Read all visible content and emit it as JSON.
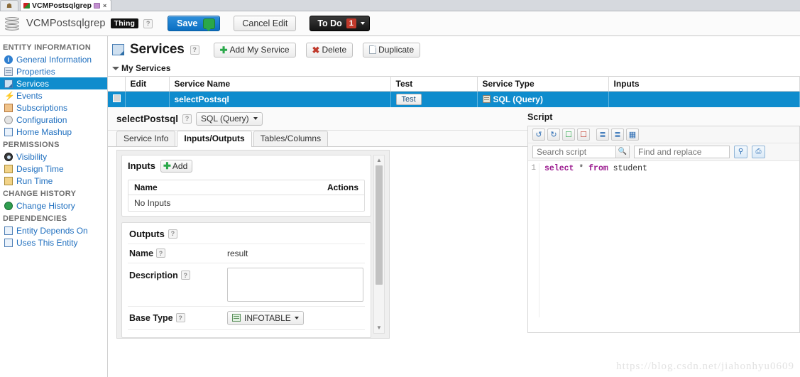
{
  "browser": {
    "home_tab_icon": "home-icon",
    "active_tab": {
      "label": "VCMPostsqlgrep",
      "favicon": "site-favicon",
      "badge_icon": "extension-badge-icon",
      "close_label": "×"
    }
  },
  "entity_bar": {
    "db_icon": "database-icon",
    "entity_name": "VCMPostsqlgrep",
    "type_badge": "Thing",
    "help_label": "?",
    "save_label": "Save",
    "save_bubble_icon": "comment-add-icon",
    "cancel_label": "Cancel Edit",
    "todo_label": "To Do",
    "todo_count": "1"
  },
  "sidebar": {
    "groups": [
      {
        "title": "ENTITY INFORMATION",
        "items": [
          {
            "label": "General Information",
            "icon": "info-icon",
            "active": false
          },
          {
            "label": "Properties",
            "icon": "properties-grid-icon",
            "active": false
          },
          {
            "label": "Services",
            "icon": "services-icon",
            "active": true
          },
          {
            "label": "Events",
            "icon": "lightning-bolt-icon",
            "active": false
          },
          {
            "label": "Subscriptions",
            "icon": "subscriptions-icon",
            "active": false
          },
          {
            "label": "Configuration",
            "icon": "gear-icon",
            "active": false
          },
          {
            "label": "Home Mashup",
            "icon": "mashup-icon",
            "active": false
          }
        ]
      },
      {
        "title": "PERMISSIONS",
        "items": [
          {
            "label": "Visibility",
            "icon": "eye-icon",
            "active": false
          },
          {
            "label": "Design Time",
            "icon": "design-time-icon",
            "active": false
          },
          {
            "label": "Run Time",
            "icon": "run-time-icon",
            "active": false
          }
        ]
      },
      {
        "title": "CHANGE HISTORY",
        "items": [
          {
            "label": "Change History",
            "icon": "history-clock-icon",
            "active": false
          }
        ]
      },
      {
        "title": "DEPENDENCIES",
        "items": [
          {
            "label": "Entity Depends On",
            "icon": "dependency-icon",
            "active": false
          },
          {
            "label": "Uses This Entity",
            "icon": "dependency-icon",
            "active": false
          }
        ]
      }
    ]
  },
  "services_page": {
    "icon": "services-icon",
    "title": "Services",
    "help_label": "?",
    "buttons": [
      {
        "label": "Add My Service",
        "icon": "plus-icon"
      },
      {
        "label": "Delete",
        "icon": "x-icon"
      },
      {
        "label": "Duplicate",
        "icon": "duplicate-doc-icon"
      }
    ],
    "section_label": "My Services",
    "table": {
      "columns": [
        "",
        "Edit",
        "Service Name",
        "Test",
        "Service Type",
        "Inputs"
      ],
      "rows": [
        {
          "checkbox": "",
          "edit": "",
          "service_name": "selectPostsql",
          "test_label": "Test",
          "service_type": "SQL (Query)",
          "service_type_icon": "sql-icon",
          "inputs": "",
          "selected": true
        }
      ]
    }
  },
  "service_detail": {
    "name": "selectPostsql",
    "help_label": "?",
    "type_select": "SQL (Query)",
    "tabs": [
      {
        "label": "Service Info",
        "active": false
      },
      {
        "label": "Inputs/Outputs",
        "active": true
      },
      {
        "label": "Tables/Columns",
        "active": false
      }
    ],
    "inputs_section": {
      "title": "Inputs",
      "add_label": "Add",
      "add_icon": "plus-icon",
      "columns": [
        "Name",
        "Actions"
      ],
      "empty_text": "No Inputs"
    },
    "outputs_section": {
      "title": "Outputs",
      "help_label": "?",
      "fields": [
        {
          "label": "Name",
          "help": "?",
          "value": "result",
          "kind": "text"
        },
        {
          "label": "Description",
          "help": "?",
          "value": "",
          "kind": "textarea"
        },
        {
          "label": "Base Type",
          "help": "?",
          "value": "INFOTABLE",
          "kind": "select",
          "icon": "infotable-icon"
        }
      ]
    }
  },
  "script_panel": {
    "title": "Script",
    "toolbar_icons": [
      "undo-icon",
      "redo-icon",
      "add-snippet-icon",
      "remove-snippet-icon",
      "indent-increase-icon",
      "indent-decrease-icon",
      "format-code-icon"
    ],
    "search_placeholder": "Search script",
    "search_value": "",
    "search_icon": "magnifier-icon",
    "find_replace_placeholder": "Find and replace",
    "find_replace_value": "",
    "find_icon": "find-icon",
    "replace_icon": "replace-icon",
    "code": {
      "line_numbers": [
        "1"
      ],
      "lines": [
        [
          {
            "t": "select",
            "c": "kw"
          },
          {
            "t": " * ",
            "c": "op"
          },
          {
            "t": "from",
            "c": "kw"
          },
          {
            "t": " student",
            "c": "id"
          }
        ]
      ]
    }
  },
  "watermark": "https://blog.csdn.net/jiahonhyu0609"
}
